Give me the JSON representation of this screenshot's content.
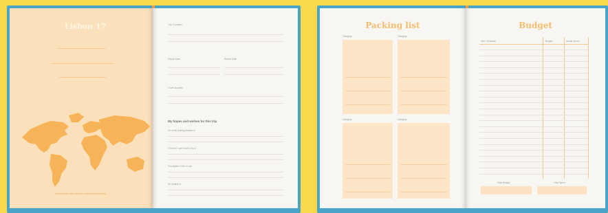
{
  "spread_left": {
    "cover": {
      "title": "Lisbon 17",
      "credit": "Lorem ipsum dolor sit amet, consectetur adipiscing"
    },
    "form": {
      "field1": "Trip / Location",
      "field2": "Depart Date",
      "field3": "Return Date",
      "field4": "Travel Buddies",
      "section": "My hopes and wishes for this trip",
      "q1": "I'm really looking forward to",
      "q2": "The food I can't wait to try is",
      "q3": "The sights I'd like to see",
      "q4": "I'm hoping to"
    }
  },
  "spread_right": {
    "packing": {
      "title": "Packing list",
      "cat1": "Category",
      "cat2": "Category",
      "cat3": "Category",
      "cat4": "Category"
    },
    "budget": {
      "title": "Budget",
      "col1": "Item / Expense",
      "col2": "Budget",
      "col3": "Actual Spent",
      "foot1": "Total Budget",
      "foot2": "Total Spent"
    }
  },
  "colors": {
    "background": "#f9d849",
    "book_cover": "#4aa4c8",
    "accent_orange": "#f3bd6e",
    "page": "#f7f6f3",
    "box_fill": "#fde5c7"
  }
}
